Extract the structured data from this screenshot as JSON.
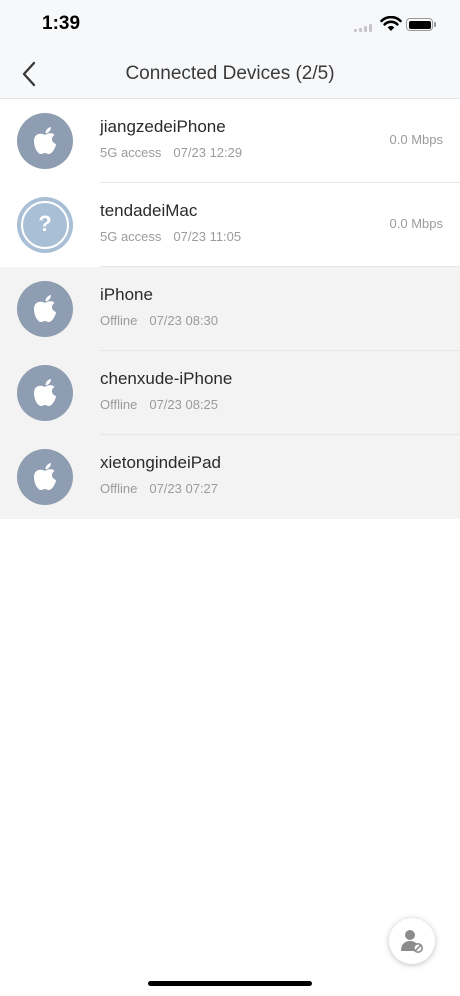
{
  "status_bar": {
    "time": "1:39"
  },
  "header": {
    "title": "Connected Devices (2/5)",
    "back_icon": "chevron-left-icon"
  },
  "devices": [
    {
      "name": "jiangzedeiPhone",
      "status": "5G access",
      "time": "07/23 12:29",
      "speed": "0.0 Mbps",
      "icon": "apple-icon"
    },
    {
      "name": "tendadeiMac",
      "status": "5G access",
      "time": "07/23 11:05",
      "speed": "0.0 Mbps",
      "icon": "unknown-device-icon",
      "icon_glyph": "?"
    },
    {
      "name": "iPhone",
      "status": "Offline",
      "time": "07/23 08:30",
      "icon": "apple-icon"
    },
    {
      "name": "chenxude-iPhone",
      "status": "Offline",
      "time": "07/23 08:25",
      "icon": "apple-icon"
    },
    {
      "name": "xietongindeiPad",
      "status": "Offline",
      "time": "07/23 07:27",
      "icon": "apple-icon"
    }
  ],
  "fab": {
    "icon": "user-blocked-icon"
  },
  "colors": {
    "avatar": "#8e9db1",
    "avatar_unknown": "#a8bfd6",
    "offline_bg": "#f3f3f3",
    "nav_bg": "#f7f8fa"
  }
}
